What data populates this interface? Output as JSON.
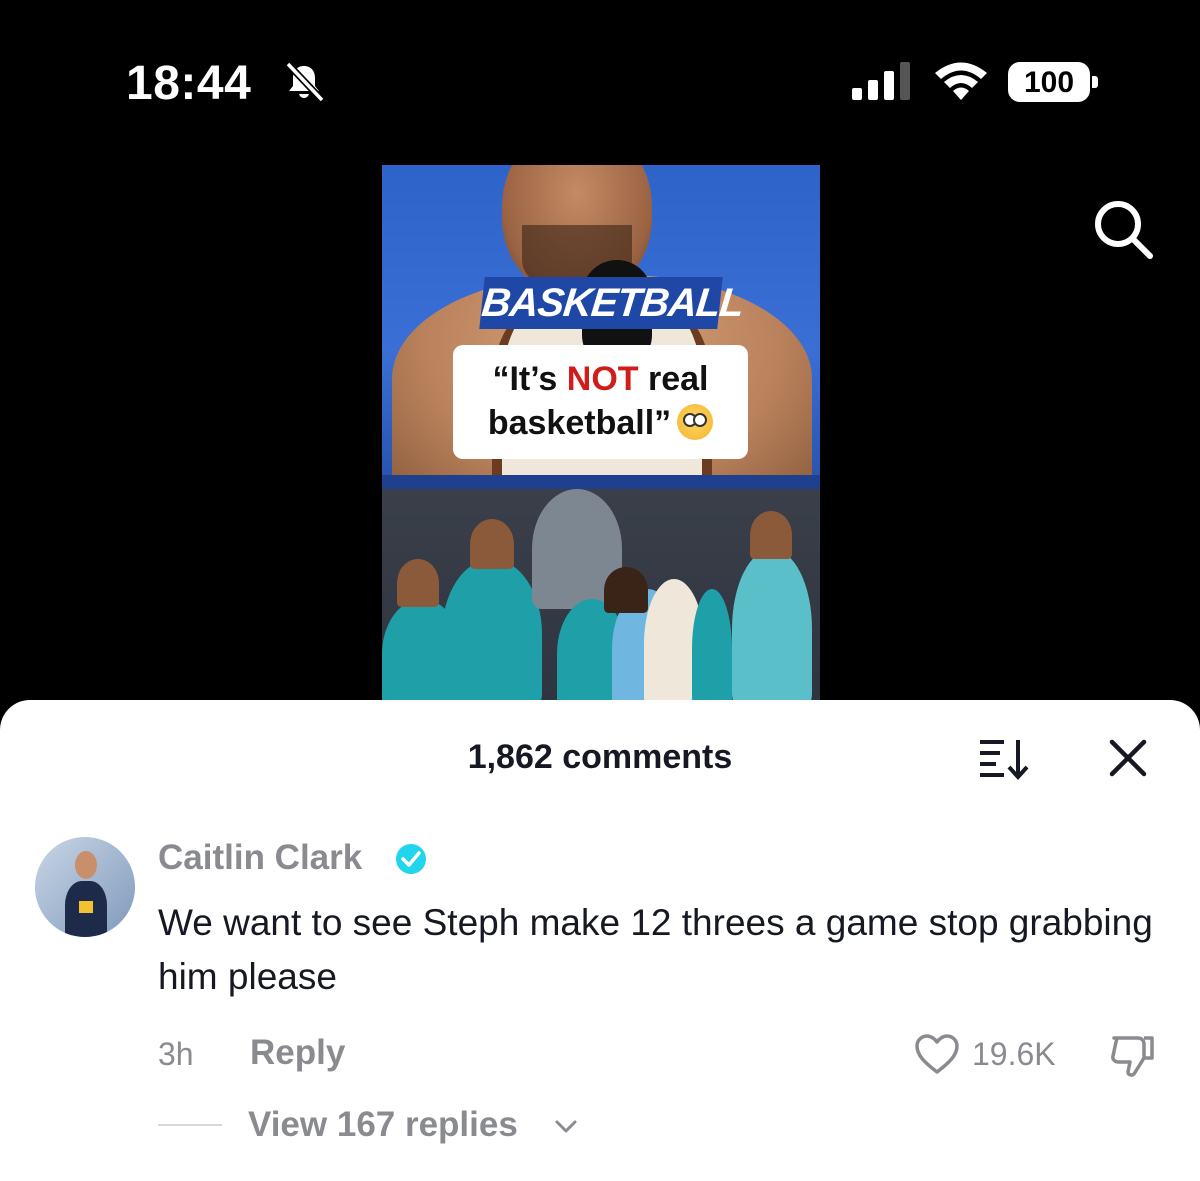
{
  "status_bar": {
    "time": "18:44",
    "battery": "100"
  },
  "video": {
    "brand_label": "BASKETBALL",
    "quote_part1": "“It’s ",
    "quote_highlight": "NOT",
    "quote_part2": " real",
    "quote_line2": "basketball”",
    "highlight_color": "#d11c1c"
  },
  "comments_sheet": {
    "title": "1,862 comments"
  },
  "comment": {
    "username": "Caitlin Clark",
    "text": "We want to see Steph make 12 threes a game stop grabbing him please",
    "time": "3h",
    "reply_label": "Reply",
    "likes": "19.6K",
    "view_replies": "View 167 replies"
  },
  "icons": [
    "bell-muted-icon",
    "signal-icon",
    "wifi-icon",
    "battery-icon",
    "search-icon",
    "sort-icon",
    "close-icon",
    "verified-icon",
    "heart-icon",
    "dislike-icon",
    "chevron-down-icon"
  ],
  "colors": {
    "verified": "#20d5ec",
    "muted_text": "#8a8b91",
    "primary_text": "#161823"
  }
}
